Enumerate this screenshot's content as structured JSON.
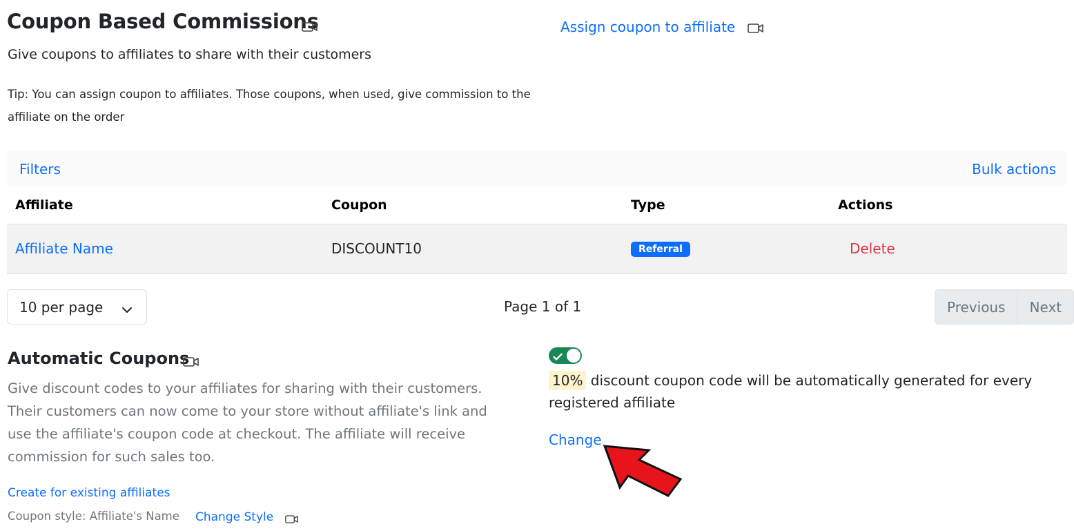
{
  "header": {
    "title": "Coupon Based Commissions",
    "subtitle": "Give coupons to affiliates to share with their customers",
    "tip": "Tip: You can assign coupon to affiliates. Those coupons, when used, give commission to the affiliate on the order",
    "assign_link": "Assign coupon to affiliate"
  },
  "toolbar": {
    "filters": "Filters",
    "bulk_actions": "Bulk actions"
  },
  "table": {
    "columns": [
      "Affiliate",
      "Coupon",
      "Type",
      "Actions"
    ],
    "rows": [
      {
        "affiliate": "Affiliate Name",
        "coupon": "DISCOUNT10",
        "type": "Referral",
        "action": "Delete"
      }
    ]
  },
  "pagination": {
    "per_page": "10 per page",
    "page_info": "Page 1 of 1",
    "previous": "Previous",
    "next": "Next"
  },
  "automatic": {
    "title": "Automatic Coupons",
    "description": "Give discount codes to your affiliates for sharing with their customers. Their customers can now come to your store without affiliate's link and use the affiliate's coupon code at checkout. The affiliate will receive commission for such sales too.",
    "enabled": true,
    "percent": "10%",
    "generated_text": " discount coupon code will be automatically generated for every registered affiliate",
    "change": "Change",
    "create_existing": "Create for existing affiliates",
    "coupon_style": "Coupon style: Affiliate's Name",
    "change_style": "Change Style"
  },
  "colors": {
    "link": "#0d6efd",
    "danger": "#dc3545",
    "toggle_on": "#198754",
    "highlight": "#fff3cd",
    "arrow": "#e8141c"
  },
  "icons": {
    "video": "video-camera-icon",
    "chevron": "chevron-down-icon",
    "check": "check-icon",
    "pointer": "red-arrow-annotation"
  }
}
